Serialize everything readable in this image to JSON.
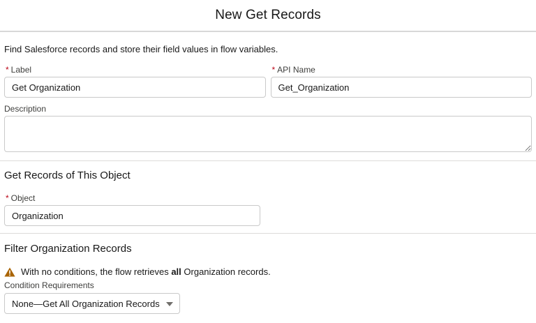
{
  "header": {
    "title": "New Get Records"
  },
  "intro": "Find Salesforce records and store their field values in flow variables.",
  "required_marker": "*",
  "fields": {
    "label": {
      "label": "Label",
      "value": "Get Organization"
    },
    "api_name": {
      "label": "API Name",
      "value": "Get_Organization"
    },
    "description": {
      "label": "Description",
      "value": ""
    }
  },
  "object_section": {
    "title": "Get Records of This Object",
    "object_label": "Object",
    "object_value": "Organization"
  },
  "filter_section": {
    "title": "Filter Organization Records",
    "warning_prefix": "With no conditions, the flow retrieves ",
    "warning_bold": "all",
    "warning_suffix": " Organization records.",
    "condition_label": "Condition Requirements",
    "condition_value": "None—Get All Organization Records"
  },
  "icons": {
    "warning": "warning-icon",
    "dropdown": "chevron-down-icon"
  },
  "colors": {
    "required": "#ba0517",
    "warning": "#a96404",
    "border": "#c9c9c9"
  }
}
